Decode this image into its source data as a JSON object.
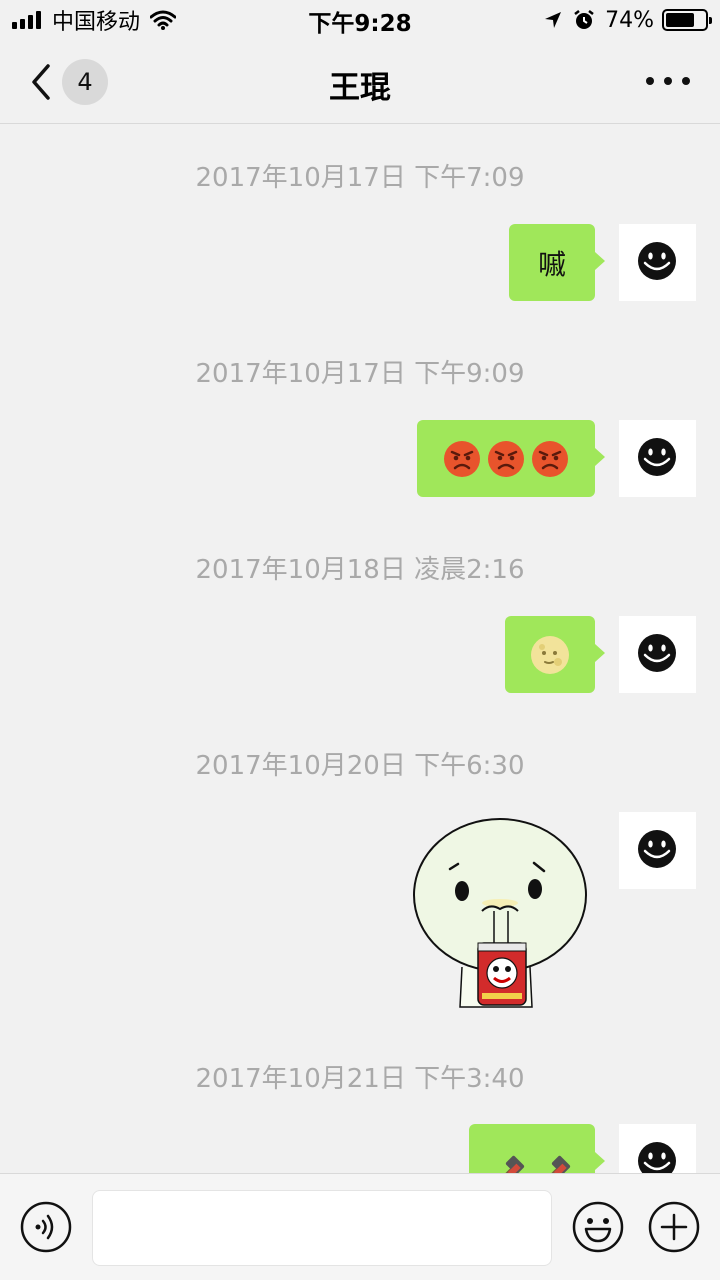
{
  "status_bar": {
    "carrier": "中国移动",
    "time": "下午9:28",
    "battery_percent": "74%",
    "battery_level": 0.74,
    "icons": [
      "signal-icon",
      "wifi-icon",
      "location-icon",
      "alarm-icon",
      "battery-icon"
    ]
  },
  "nav": {
    "back_icon": "chevron-left-icon",
    "unread_count": "4",
    "title": "王琨",
    "more_icon": "more-dots-icon"
  },
  "messages": [
    {
      "timestamp": "2017年10月17日 下午7:09",
      "type": "text",
      "content": "嘁"
    },
    {
      "timestamp": "2017年10月17日 下午9:09",
      "type": "emoji",
      "emojis": [
        "angry-face",
        "angry-face",
        "angry-face"
      ]
    },
    {
      "timestamp": "2017年10月18日 凌晨2:16",
      "type": "emoji",
      "emojis": [
        "full-moon-face"
      ]
    },
    {
      "timestamp": "2017年10月20日 下午6:30",
      "type": "sticker",
      "sticker": "cartoon-drinking-can-sticker"
    },
    {
      "timestamp": "2017年10月21日 下午3:40",
      "type": "emoji",
      "emojis": [
        "hammer",
        "hammer"
      ]
    }
  ],
  "avatar_icon": "smiley-face-icon",
  "input_bar": {
    "voice_icon": "voice-icon",
    "emoji_icon": "emoji-icon",
    "add_icon": "add-icon",
    "input_value": ""
  },
  "colors": {
    "background": "#f1f1f1",
    "bubble": "#a0e75a",
    "timestamp_text": "#a9a9a9"
  }
}
